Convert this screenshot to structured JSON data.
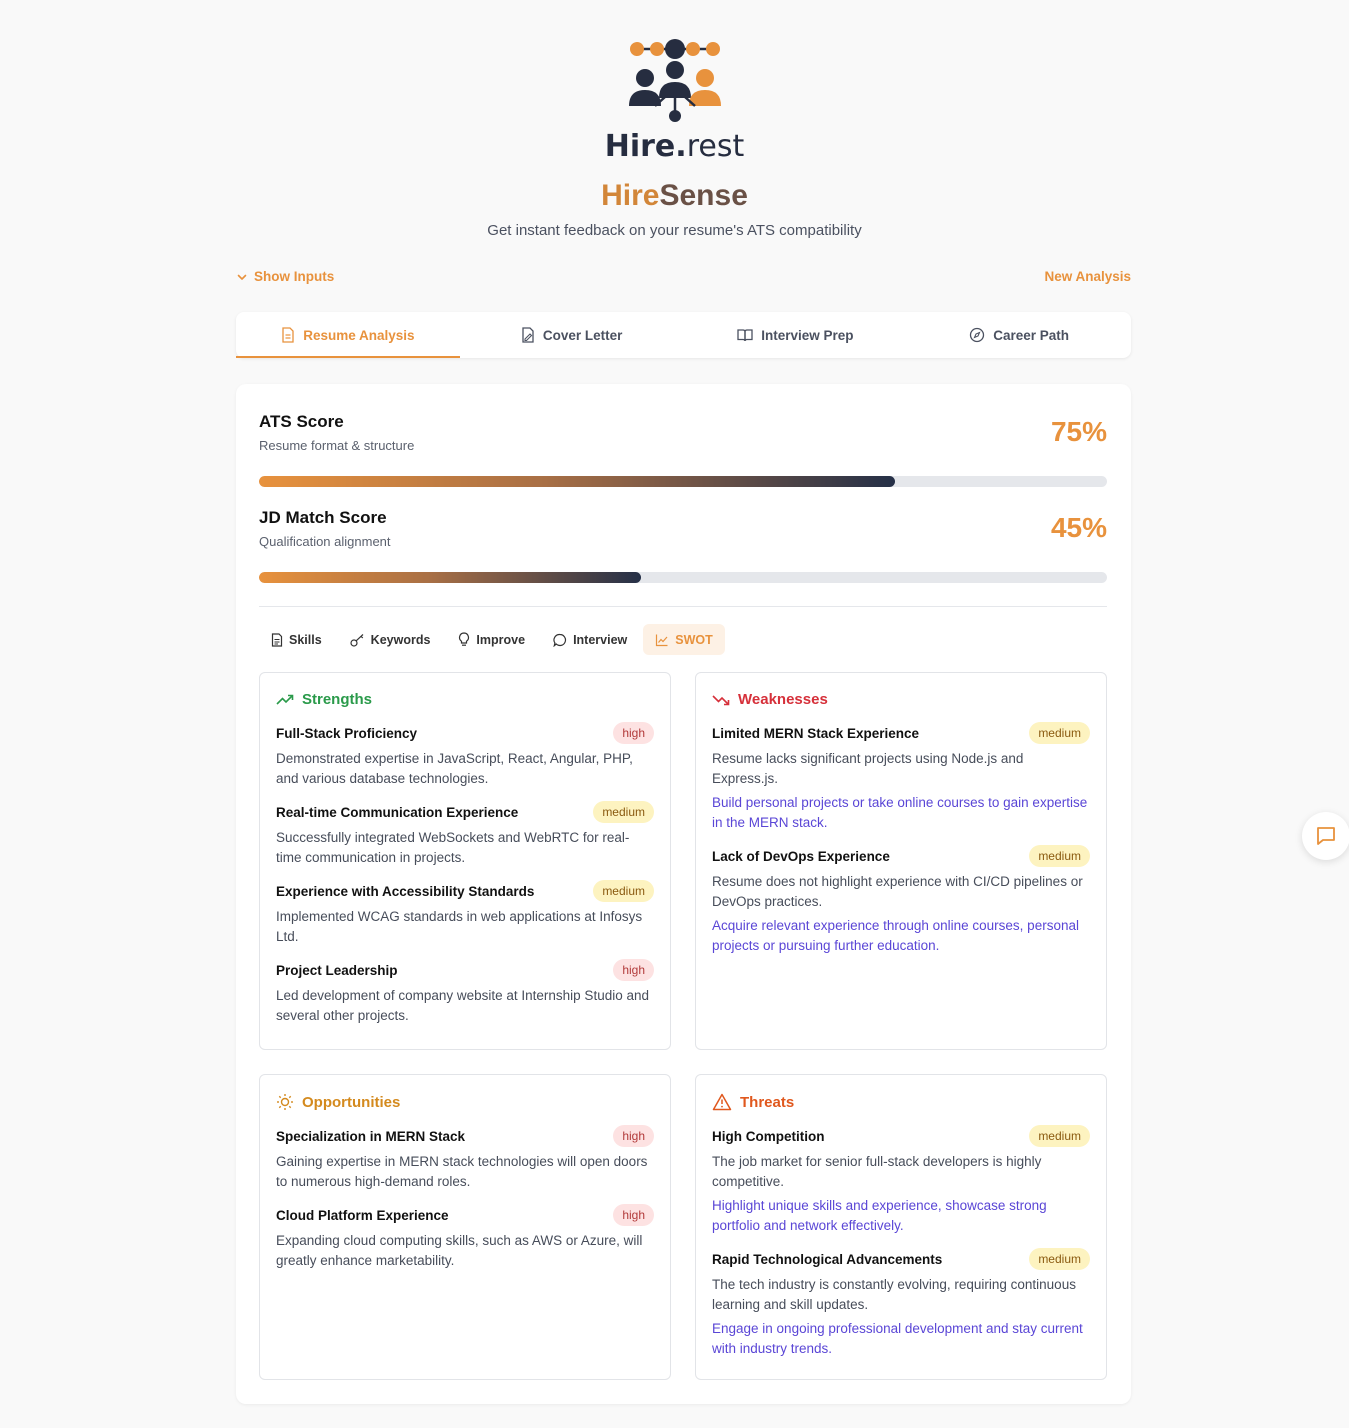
{
  "brand": {
    "logo_word": "Hire",
    "logo_dot": ".",
    "logo_suffix": "rest",
    "title_part1": "Hire",
    "title_part2": "Sense",
    "subtitle": "Get instant feedback on your resume's ATS compatibility",
    "colors": {
      "orange": "#e8923d",
      "navy": "#262d40",
      "link": "#5a46d6"
    }
  },
  "controls": {
    "show_inputs": "Show Inputs",
    "new_analysis": "New Analysis"
  },
  "main_tabs": [
    {
      "label": "Resume Analysis",
      "icon": "document-icon",
      "active": true
    },
    {
      "label": "Cover Letter",
      "icon": "file-edit-icon",
      "active": false
    },
    {
      "label": "Interview Prep",
      "icon": "book-open-icon",
      "active": false
    },
    {
      "label": "Career Path",
      "icon": "compass-icon",
      "active": false
    }
  ],
  "scores": {
    "ats": {
      "title": "ATS Score",
      "subtitle": "Resume format & structure",
      "value": "75%",
      "fraction": 0.75
    },
    "jd": {
      "title": "JD Match Score",
      "subtitle": "Qualification alignment",
      "value": "45%",
      "fraction": 0.45
    }
  },
  "sub_tabs": [
    {
      "label": "Skills",
      "icon": "file-text-icon",
      "active": false
    },
    {
      "label": "Keywords",
      "icon": "key-icon",
      "active": false
    },
    {
      "label": "Improve",
      "icon": "lightbulb-icon",
      "active": false
    },
    {
      "label": "Interview",
      "icon": "message-circle-icon",
      "active": false
    },
    {
      "label": "SWOT",
      "icon": "line-chart-icon",
      "active": true
    }
  ],
  "swot": {
    "strengths": {
      "title": "Strengths",
      "color": "#2a9a4a",
      "items": [
        {
          "title": "Full-Stack Proficiency",
          "level": "high",
          "desc": "Demonstrated expertise in JavaScript, React, Angular, PHP, and various database technologies."
        },
        {
          "title": "Real-time Communication Experience",
          "level": "medium",
          "desc": "Successfully integrated WebSockets and WebRTC for real-time communication in projects."
        },
        {
          "title": "Experience with Accessibility Standards",
          "level": "medium",
          "desc": "Implemented WCAG standards in web applications at Infosys Ltd."
        },
        {
          "title": "Project Leadership",
          "level": "high",
          "desc": "Led development of company website at Internship Studio and several other projects."
        }
      ]
    },
    "weaknesses": {
      "title": "Weaknesses",
      "color": "#d6303a",
      "items": [
        {
          "title": "Limited MERN Stack Experience",
          "level": "medium",
          "desc": "Resume lacks significant projects using Node.js and Express.js.",
          "fix": "Build personal projects or take online courses to gain expertise in the MERN stack."
        },
        {
          "title": "Lack of DevOps Experience",
          "level": "medium",
          "desc": "Resume does not highlight experience with CI/CD pipelines or DevOps practices.",
          "fix": "Acquire relevant experience through online courses, personal projects or pursuing further education."
        }
      ]
    },
    "opportunities": {
      "title": "Opportunities",
      "color": "#d48a1e",
      "items": [
        {
          "title": "Specialization in MERN Stack",
          "level": "high",
          "desc": "Gaining expertise in MERN stack technologies will open doors to numerous high-demand roles."
        },
        {
          "title": "Cloud Platform Experience",
          "level": "high",
          "desc": "Expanding cloud computing skills, such as AWS or Azure, will greatly enhance marketability."
        }
      ]
    },
    "threats": {
      "title": "Threats",
      "color": "#e0581e",
      "items": [
        {
          "title": "High Competition",
          "level": "medium",
          "desc": "The job market for senior full-stack developers is highly competitive.",
          "fix": "Highlight unique skills and experience, showcase strong portfolio and network effectively."
        },
        {
          "title": "Rapid Technological Advancements",
          "level": "medium",
          "desc": "The tech industry is constantly evolving, requiring continuous learning and skill updates.",
          "fix": "Engage in ongoing professional development and stay current with industry trends."
        }
      ]
    }
  },
  "chat": {
    "icon": "chat-icon"
  }
}
